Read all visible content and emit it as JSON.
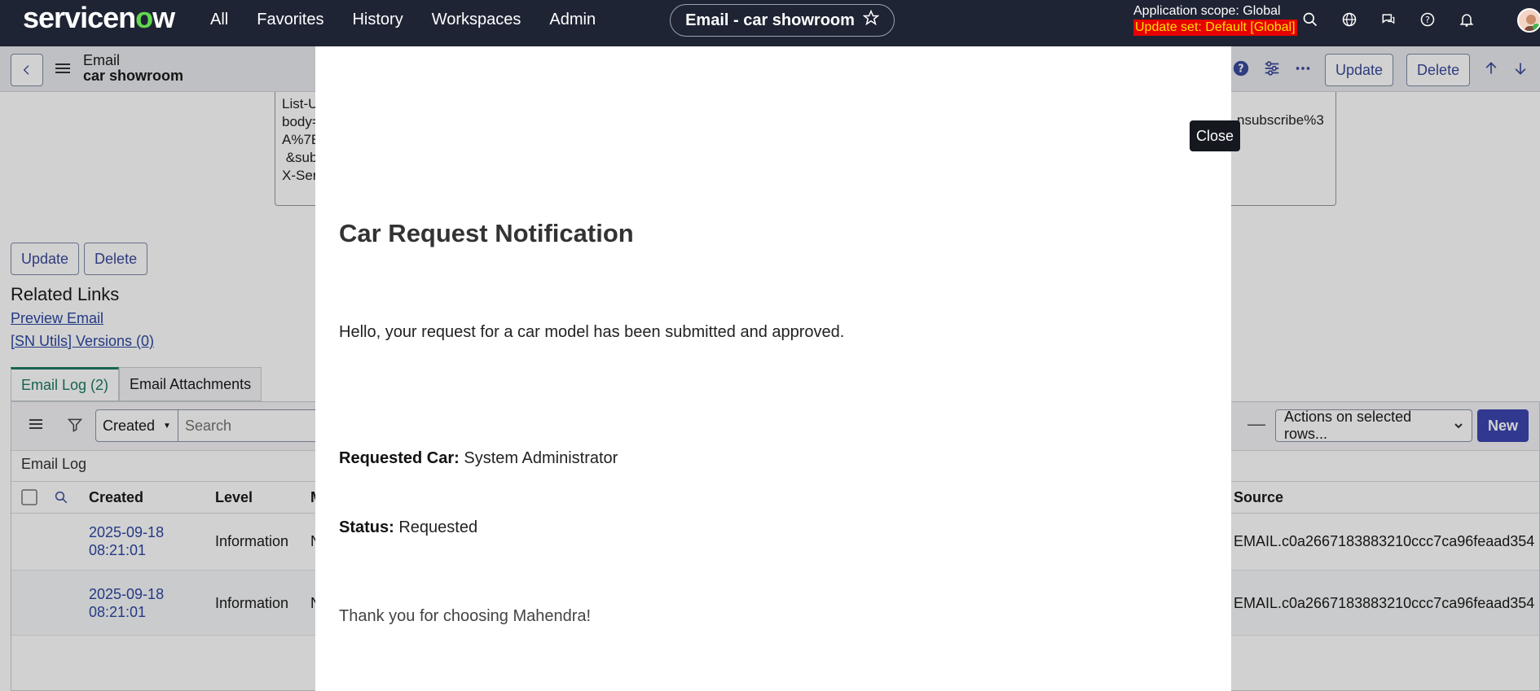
{
  "nav": {
    "logo": "servicenow",
    "links": [
      "All",
      "Favorites",
      "History",
      "Workspaces",
      "Admin"
    ],
    "pill_title": "Email - car showroom",
    "scope_label": "Application scope: Global",
    "update_set": "Update set: Default [Global]",
    "icons": [
      "search-icon",
      "globe-icon",
      "chat-icon",
      "help-icon",
      "bell-icon"
    ]
  },
  "form": {
    "title_line1": "Email",
    "title_line2": "car showroom",
    "update_label": "Update",
    "delete_label": "Delete"
  },
  "headers_box": {
    "lines": [
      "List-U",
      "body=",
      "A%7E",
      " &sub",
      "X-Ser"
    ],
    "right_text": "nsubscribe%3"
  },
  "bottom_buttons": {
    "update": "Update",
    "delete": "Delete"
  },
  "related": {
    "title": "Related Links",
    "links": [
      "Preview Email",
      "[SN Utils] Versions (0)"
    ]
  },
  "tabs": [
    "Email Log (2)",
    "Email Attachments"
  ],
  "list": {
    "filter_field": "Created",
    "search_placeholder": "Search",
    "actions": "Actions on selected rows...",
    "new_label": "New",
    "caption": "Email Log",
    "columns": {
      "created": "Created",
      "level": "Level",
      "message": "M",
      "source": "Source"
    },
    "rows": [
      {
        "date": "2025-09-18",
        "time": "08:21:01",
        "level": "Information",
        "message": "N",
        "source": "EMAIL.c0a2667183883210ccc7ca96feaad354"
      },
      {
        "date": "2025-09-18",
        "time": "08:21:01",
        "level": "Information",
        "message": "N",
        "source": "EMAIL.c0a2667183883210ccc7ca96feaad354"
      }
    ]
  },
  "modal": {
    "close_label": "Close",
    "heading": "Car Request Notification",
    "intro": "Hello, your request for a car model has been submitted and approved.",
    "car_label": "Requested Car:",
    "car_value": "System Administrator",
    "status_label": "Status:",
    "status_value": "Requested",
    "thanks": "Thank you for choosing Mahendra!"
  },
  "colors": {
    "nav_bg": "#1f2434",
    "accent": "#3c45b0",
    "update_set_bg": "#e60000",
    "update_set_fg": "#ffe100",
    "tab_active": "#1c7a63"
  }
}
